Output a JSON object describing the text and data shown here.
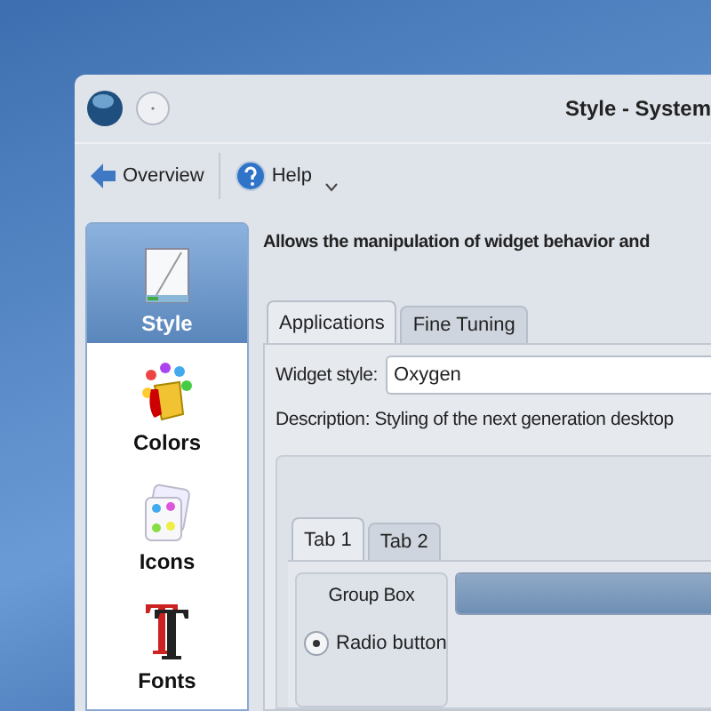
{
  "window": {
    "title": "Style - System"
  },
  "toolbar": [
    {
      "label": "Overview",
      "kind": "back"
    },
    {
      "label": "Help",
      "kind": "help"
    }
  ],
  "sidebar": {
    "items": [
      {
        "label": "Style",
        "kind": "style",
        "selected": true
      },
      {
        "label": "Colors",
        "kind": "colors",
        "selected": false
      },
      {
        "label": "Icons",
        "kind": "icons",
        "selected": false
      },
      {
        "label": "Fonts",
        "kind": "fonts",
        "selected": false
      }
    ]
  },
  "content": {
    "heading": "Allows the manipulation of widget behavior and",
    "tabs": [
      {
        "label": "Applications",
        "selected": true
      },
      {
        "label": "Fine Tuning",
        "selected": false
      }
    ],
    "widget_style": {
      "label": "Widget style:",
      "value": "Oxygen"
    },
    "description": "Description: Styling of the next generation desktop",
    "preview": {
      "tabs": [
        {
          "label": "Tab 1",
          "selected": true
        },
        {
          "label": "Tab 2",
          "selected": false
        }
      ],
      "group_box": {
        "title": "Group Box",
        "radio": {
          "label": "Radio button",
          "selected": true
        }
      },
      "progress": {
        "level": 1
      }
    }
  }
}
